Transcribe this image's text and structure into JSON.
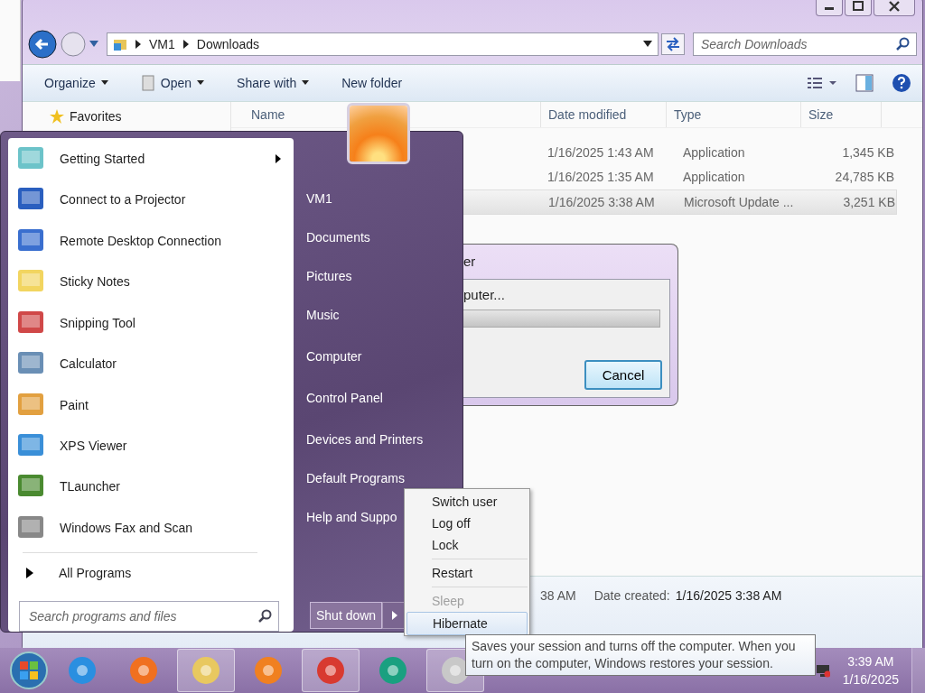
{
  "explorer": {
    "breadcrumb": [
      "VM1",
      "Downloads"
    ],
    "search": {
      "placeholder": "Search Downloads"
    },
    "toolbar": [
      {
        "label": "Organize",
        "dropdown": true
      },
      {
        "label": "Open",
        "dropdown": true
      },
      {
        "label": "Share with",
        "dropdown": true
      },
      {
        "label": "New folder",
        "dropdown": false
      }
    ],
    "nav_pane": [
      "Favorites"
    ],
    "columns": [
      "Name",
      "Date modified",
      "Type",
      "Size"
    ],
    "rows": [
      {
        "date": "1/16/2025 1:43 AM",
        "type": "Application",
        "size": "1,345 KB",
        "selected": false
      },
      {
        "date": "1/16/2025 1:35 AM",
        "type": "Application",
        "size": "24,785 KB",
        "selected": false
      },
      {
        "date": "1/16/2025 3:38 AM",
        "type": "Microsoft Update ...",
        "size": "3,251 KB",
        "selected": true
      }
    ],
    "details": {
      "column_1": "38 AM",
      "date_created_label": "Date created:",
      "date_created": "1/16/2025 3:38 AM"
    }
  },
  "dialog": {
    "title": "er",
    "message": "puter...",
    "level": 1,
    "buttons": [
      "Cancel"
    ]
  },
  "start_menu": {
    "programs": [
      {
        "label": "Getting Started",
        "has_submenu": true
      },
      {
        "label": "Connect to a Projector",
        "has_submenu": false
      },
      {
        "label": "Remote Desktop Connection",
        "has_submenu": false
      },
      {
        "label": "Sticky Notes",
        "has_submenu": false
      },
      {
        "label": "Snipping Tool",
        "has_submenu": false
      },
      {
        "label": "Calculator",
        "has_submenu": false
      },
      {
        "label": "Paint",
        "has_submenu": false
      },
      {
        "label": "XPS Viewer",
        "has_submenu": false
      },
      {
        "label": "TLauncher",
        "has_submenu": false
      },
      {
        "label": "Windows Fax and Scan",
        "has_submenu": false
      }
    ],
    "all_programs": "All Programs",
    "search": {
      "placeholder": "Search programs and files"
    },
    "places": [
      "VM1",
      "Documents",
      "Pictures",
      "Music",
      "Computer",
      "Control Panel",
      "Devices and Printers",
      "Default Programs",
      "Help and Suppo"
    ],
    "shutdown": "Shut down"
  },
  "shutdown_menu": [
    {
      "kind": "item",
      "label": "Switch user",
      "disabled": false,
      "selected": false
    },
    {
      "kind": "item",
      "label": "Log off",
      "disabled": false,
      "selected": false
    },
    {
      "kind": "item",
      "label": "Lock",
      "disabled": false,
      "selected": false
    },
    {
      "kind": "separator"
    },
    {
      "kind": "item",
      "label": "Restart",
      "disabled": false,
      "selected": false
    },
    {
      "kind": "separator"
    },
    {
      "kind": "item",
      "label": "Sleep",
      "disabled": true,
      "selected": false
    },
    {
      "kind": "item",
      "label": "Hibernate",
      "disabled": false,
      "selected": true
    }
  ],
  "tooltip": "Saves your session and turns off the computer. When you turn on the computer, Windows restores your session.",
  "clock": {
    "time": "3:39 AM",
    "date": "1/16/2025"
  }
}
